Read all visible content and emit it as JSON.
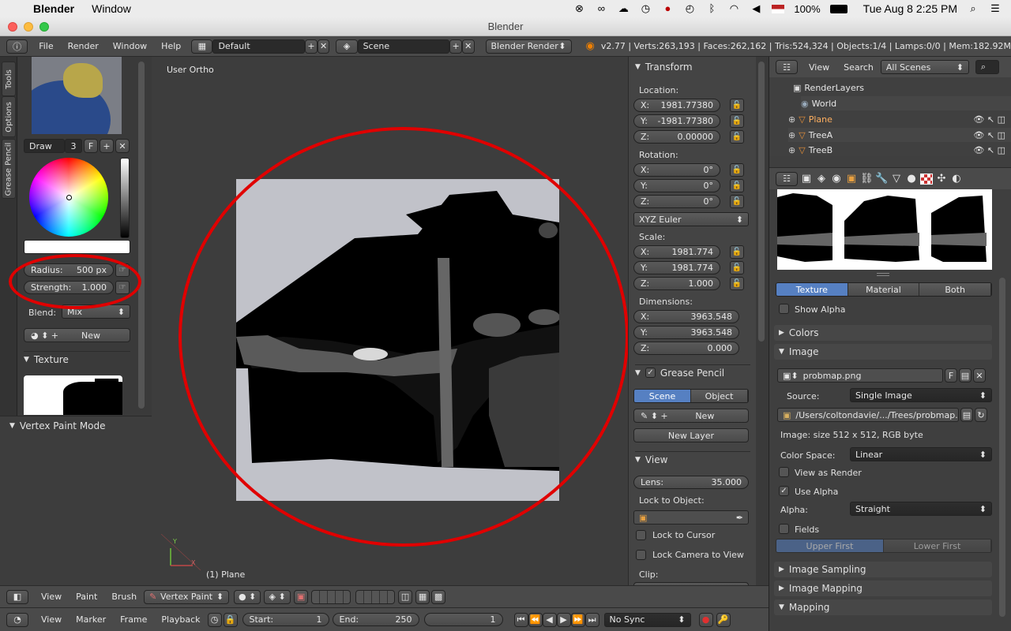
{
  "mac": {
    "app": "Blender",
    "menu_window": "Window",
    "battery": "100%",
    "datetime": "Tue Aug 8  2:25 PM"
  },
  "window": {
    "title": "Blender"
  },
  "topbar": {
    "menus": [
      "File",
      "Render",
      "Window",
      "Help"
    ],
    "layout": "Default",
    "scene": "Scene",
    "engine": "Blender Render",
    "stats": "v2.77 | Verts:263,193 | Faces:262,162 | Tris:524,324 | Objects:1/4 | Lamps:0/0 | Mem:182.92M"
  },
  "tools": {
    "tabs": [
      "Tools",
      "Options",
      "Grease Pencil"
    ],
    "brush_name": "Draw",
    "brush_users": "3",
    "brush_fake": "F",
    "radius_label": "Radius:",
    "radius_value": "500 px",
    "strength_label": "Strength:",
    "strength_value": "1.000",
    "blend_label": "Blend:",
    "blend_value": "Mix",
    "new_label": "New",
    "texture_panel": "Texture",
    "mode_panel": "Vertex Paint Mode"
  },
  "viewport": {
    "view_name": "User Ortho",
    "object_label": "(1) Plane",
    "axis_y": "Y",
    "axis_x": "X"
  },
  "npanel": {
    "transform": "Transform",
    "location": "Location:",
    "loc": [
      {
        "a": "X:",
        "v": "1981.77380"
      },
      {
        "a": "Y:",
        "v": "-1981.77380"
      },
      {
        "a": "Z:",
        "v": "0.00000"
      }
    ],
    "rotation": "Rotation:",
    "rot": [
      {
        "a": "X:",
        "v": "0°"
      },
      {
        "a": "Y:",
        "v": "0°"
      },
      {
        "a": "Z:",
        "v": "0°"
      }
    ],
    "euler": "XYZ Euler",
    "scale": "Scale:",
    "scl": [
      {
        "a": "X:",
        "v": "1981.774"
      },
      {
        "a": "Y:",
        "v": "1981.774"
      },
      {
        "a": "Z:",
        "v": "1.000"
      }
    ],
    "dimensions": "Dimensions:",
    "dim": [
      {
        "a": "X:",
        "v": "3963.548"
      },
      {
        "a": "Y:",
        "v": "3963.548"
      },
      {
        "a": "Z:",
        "v": "0.000"
      }
    ],
    "grease": "Grease Pencil",
    "gp_scene": "Scene",
    "gp_object": "Object",
    "gp_new": "New",
    "gp_new_layer": "New Layer",
    "view": "View",
    "lens_label": "Lens:",
    "lens_value": "35.000",
    "lock_obj": "Lock to Object:",
    "lock_cursor": "Lock to Cursor",
    "lock_camera": "Lock Camera to View",
    "clip": "Clip:"
  },
  "outliner": {
    "view": "View",
    "search": "Search",
    "scenes": "All Scenes",
    "items": [
      "RenderLayers",
      "World",
      "Plane",
      "TreeA",
      "TreeB"
    ]
  },
  "props": {
    "tex_tab": "Texture",
    "mat_tab": "Material",
    "both_tab": "Both",
    "show_alpha": "Show Alpha",
    "colors": "Colors",
    "image": "Image",
    "img_name": "probmap.png",
    "img_f": "F",
    "source_label": "Source:",
    "source_value": "Single Image",
    "path": "/Users/coltondavie/.../Trees/probmap.png",
    "img_info": "Image: size 512 x 512, RGB byte",
    "colorspace_label": "Color Space:",
    "colorspace_value": "Linear",
    "view_render": "View as Render",
    "use_alpha": "Use Alpha",
    "alpha_label": "Alpha:",
    "alpha_value": "Straight",
    "fields": "Fields",
    "upper_first": "Upper First",
    "lower_first": "Lower First",
    "sampling": "Image Sampling",
    "mapping_img": "Image Mapping",
    "mapping": "Mapping"
  },
  "bottom1": {
    "view": "View",
    "paint": "Paint",
    "brush": "Brush",
    "mode": "Vertex Paint"
  },
  "bottom2": {
    "view": "View",
    "marker": "Marker",
    "frame": "Frame",
    "playback": "Playback",
    "start_label": "Start:",
    "start_value": "1",
    "end_label": "End:",
    "end_value": "250",
    "current": "1",
    "sync": "No Sync"
  },
  "colors": {
    "accent": "#5680c2",
    "annotation": "#e00000"
  }
}
